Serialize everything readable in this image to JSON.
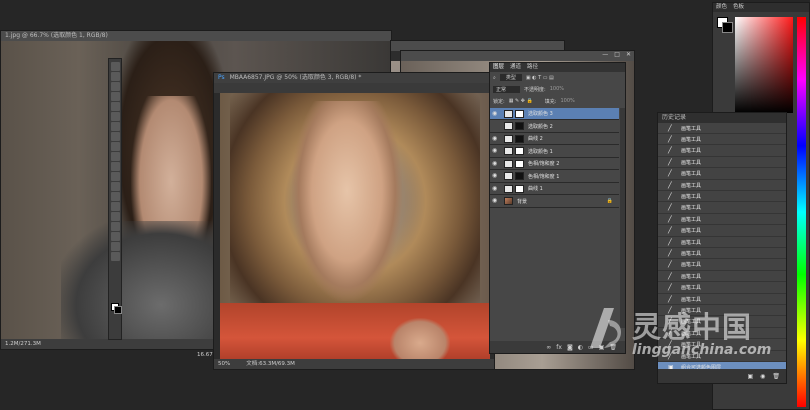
{
  "doc_back": {
    "title": "1.jpg @ 66.7% (选取颜色 1, RGB/8)",
    "size_text": "1.2M/271.3M",
    "zoom_text": "16.67%"
  },
  "doc_front": {
    "title": "MBAA6857.JPG @ 50% (选取颜色 3, RGB/8) *",
    "zoom": "50%",
    "doc_info": "文档:63.3M/69.3M"
  },
  "layers_panel": {
    "tabs": [
      "图层",
      "通道",
      "路径"
    ],
    "kind_label": "类型",
    "blend_mode": "正常",
    "opacity_label": "不透明度:",
    "opacity_value": "100%",
    "lock_label": "锁定:",
    "fill_label": "填充:",
    "fill_value": "100%",
    "layers": [
      {
        "name": "选取颜色 3",
        "selected": true,
        "mask": "white",
        "eye": true
      },
      {
        "name": "选取颜色 2",
        "selected": false,
        "mask": "black",
        "eye": false
      },
      {
        "name": "曲线 2",
        "selected": false,
        "mask": "black",
        "eye": true
      },
      {
        "name": "选取颜色 1",
        "selected": false,
        "mask": "white",
        "eye": true
      },
      {
        "name": "色相/饱和度 2",
        "selected": false,
        "mask": "white",
        "eye": true
      },
      {
        "name": "色相/饱和度 1",
        "selected": false,
        "mask": "black",
        "eye": true
      },
      {
        "name": "曲线 1",
        "selected": false,
        "mask": "white",
        "eye": true
      },
      {
        "name": "背景",
        "selected": false,
        "mask": "none",
        "eye": true
      }
    ],
    "footer_icons": [
      "link-icon",
      "fx-icon",
      "mask-icon",
      "adjustment-icon",
      "folder-icon",
      "new-layer-icon",
      "trash-icon"
    ]
  },
  "history_panel": {
    "title": "历史记录",
    "items": [
      "画笔工具",
      "画笔工具",
      "画笔工具",
      "画笔工具",
      "画笔工具",
      "画笔工具",
      "画笔工具",
      "画笔工具",
      "画笔工具",
      "画笔工具",
      "画笔工具",
      "画笔工具",
      "画笔工具",
      "画笔工具",
      "画笔工具",
      "画笔工具",
      "画笔工具",
      "画笔工具",
      "画笔工具",
      "画笔工具",
      "画笔工具"
    ],
    "last_item": "组合可选颜色图层"
  },
  "color_panel": {
    "tabs": [
      "颜色",
      "色板"
    ],
    "accent": "#ff0000"
  },
  "watermark": {
    "logo_text": "灵感中国",
    "url_text": "lingganchina.com"
  }
}
